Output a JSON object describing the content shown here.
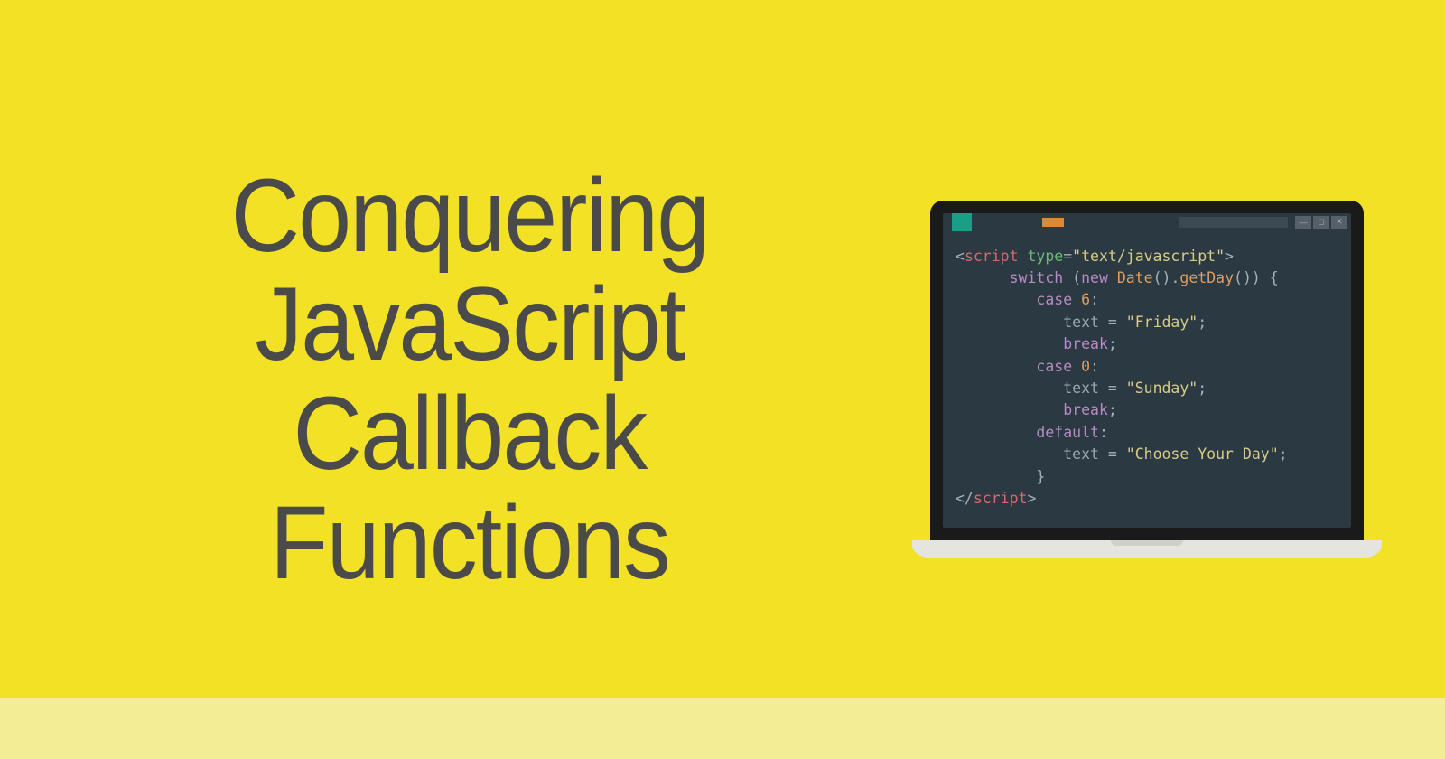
{
  "title": {
    "line1": "Conquering",
    "line2": "JavaScript",
    "line3": "Callback Functions"
  },
  "code": {
    "l1": {
      "open": "<",
      "tag": "script",
      "attr": " type",
      "eq": "=",
      "val": "\"text/javascript\"",
      "close": ">"
    },
    "l2": {
      "indent": "      ",
      "kw": "switch",
      "paren": " (",
      "new": "new",
      "space": " ",
      "date": "Date",
      "call": "().",
      "fn": "getDay",
      "end": "()) {"
    },
    "l3": {
      "indent": "         ",
      "kw": "case",
      "num": " 6",
      "colon": ":"
    },
    "l4": {
      "indent": "            ",
      "var": "text ",
      "eq": "= ",
      "str": "\"Friday\"",
      "semi": ";"
    },
    "l5": {
      "indent": "            ",
      "kw": "break",
      "semi": ";"
    },
    "l6": {
      "indent": "         ",
      "kw": "case",
      "num": " 0",
      "colon": ":"
    },
    "l7": {
      "indent": "            ",
      "var": "text ",
      "eq": "= ",
      "str": "\"Sunday\"",
      "semi": ";"
    },
    "l8": {
      "indent": "            ",
      "kw": "break",
      "semi": ";"
    },
    "l9": {
      "indent": "         ",
      "kw": "default",
      "colon": ":"
    },
    "l10": {
      "indent": "            ",
      "var": "text ",
      "eq": "= ",
      "str": "\"Choose Your Day\"",
      "semi": ";"
    },
    "l11": {
      "indent": "         ",
      "brace": "}"
    },
    "l12": {
      "open": "</",
      "tag": "script",
      "close": ">"
    }
  },
  "window_controls": {
    "min": "—",
    "max": "◻",
    "close": "✕"
  }
}
